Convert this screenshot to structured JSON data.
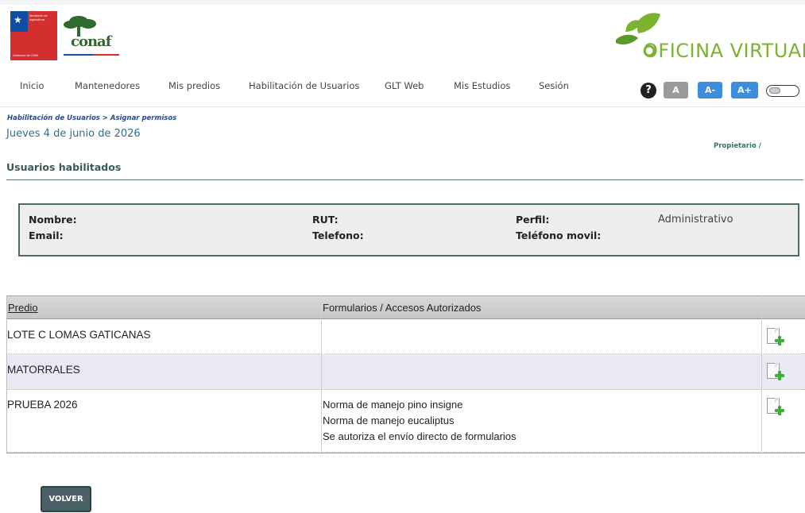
{
  "header": {
    "gov_logo_line1": "Ministerio de",
    "gov_logo_line2": "Agricultura",
    "gov_logo_bottom": "Gobierno de Chile",
    "conaf_brand": "conaf",
    "portal_name": "OFICINA VIRTUAL"
  },
  "nav": {
    "items": [
      "Inicio",
      "Mantenedores",
      "Mis predios",
      "Habilitación de Usuarios",
      "GLT Web",
      "Mis Estudios",
      "Sesión"
    ],
    "help": "?",
    "font_normal": "A",
    "font_smaller": "A-",
    "font_larger": "A+"
  },
  "breadcrumb": "Habilitación de Usuarios > Asignar permisos",
  "date": "Jueves 4 de junio de 2026",
  "role": "Propietario /",
  "section_title": "Usuarios habilitados",
  "user_info": {
    "nombre_label": "Nombre:",
    "email_label": "Email:",
    "rut_label": "RUT:",
    "telefono_label": "Telefono:",
    "perfil_label": "Perfil:",
    "telefono_movil_label": "Teléfono movil:",
    "perfil_value": "Administrativo"
  },
  "table": {
    "headers": [
      "Predio",
      "Formularios / Accesos Autorizados",
      ""
    ],
    "rows": [
      {
        "predio": "LOTE C LOMAS GATICANAS",
        "accesos": []
      },
      {
        "predio": "MATORRALES",
        "accesos": []
      },
      {
        "predio": "PRUEBA 2026",
        "accesos": [
          "Norma de manejo pino insigne",
          "Norma de manejo eucaliptus",
          "Se autoriza el envío directo de formularios"
        ]
      }
    ]
  },
  "buttons": {
    "volver": "VOLVER"
  },
  "colors": {
    "accent_green": "#7bb22f",
    "date_teal": "#2e6f8e",
    "box_border": "#4d6a66",
    "row_alt": "#e9e9f4",
    "button_bg": "#4a6266",
    "font_btn_gray": "#9a9a9a",
    "font_btn_blue": "#3c8dde"
  }
}
